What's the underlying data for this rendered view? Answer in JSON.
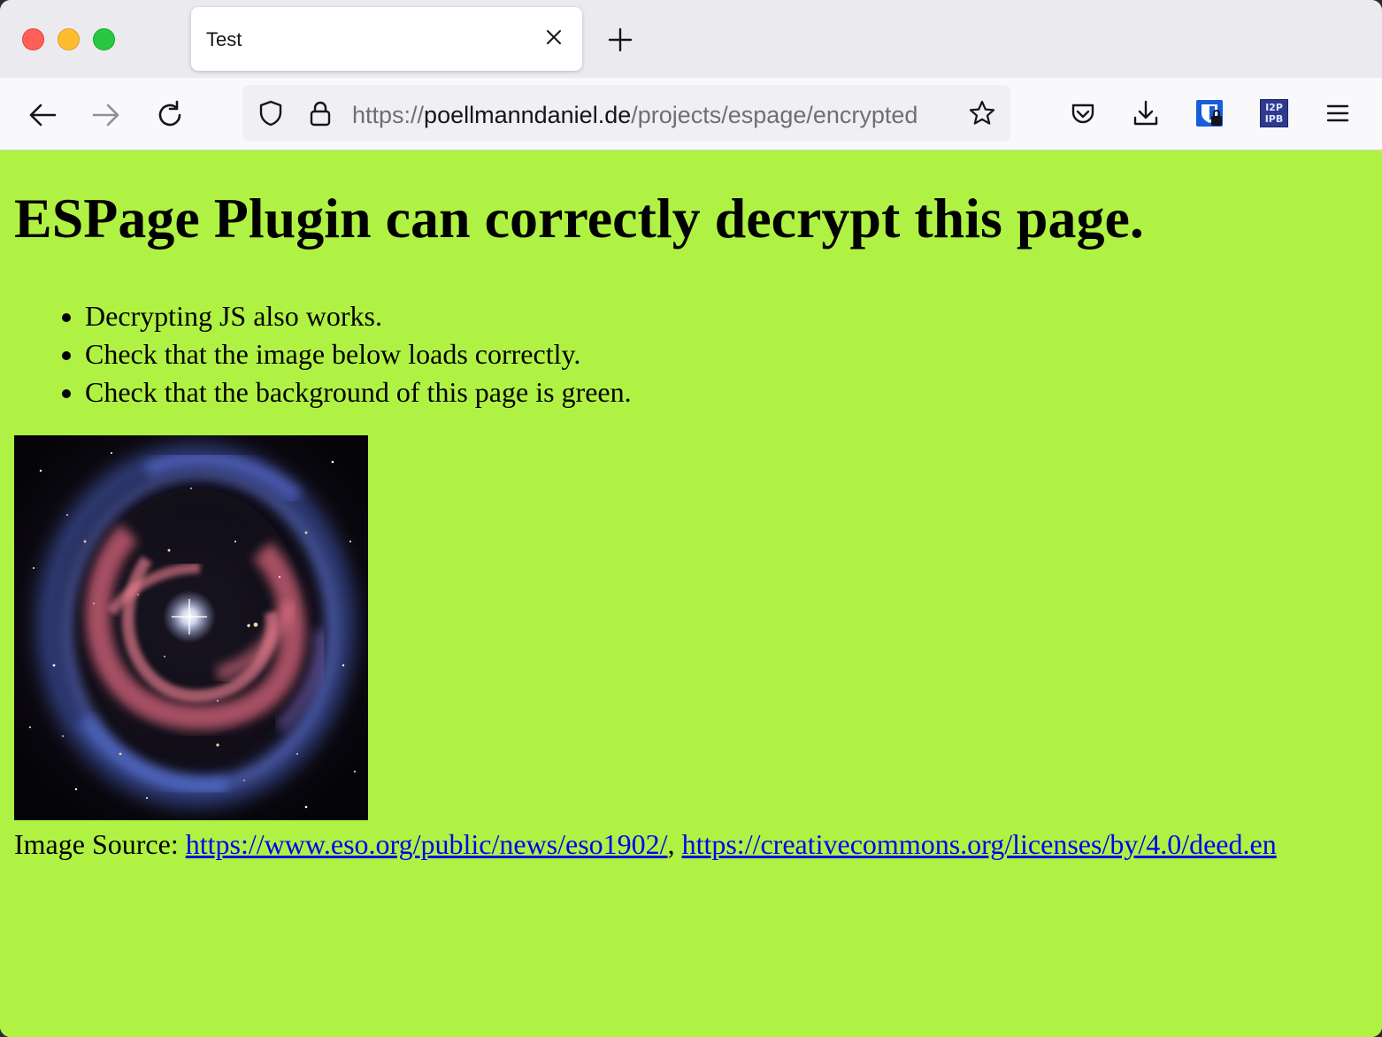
{
  "browser": {
    "tab": {
      "title": "Test"
    },
    "address": {
      "scheme": "https://",
      "host": "poellmanndaniel.de",
      "path": "/projects/espage/encrypted"
    },
    "extensions": {
      "i2p_badge_top": "I2P",
      "i2p_badge_bottom": "IPB"
    }
  },
  "page": {
    "background": "#b0f244",
    "heading": "ESPage Plugin can correctly decrypt this page.",
    "bullets": [
      "Decrypting JS also works.",
      "Check that the image below loads correctly.",
      "Check that the background of this page is green."
    ],
    "image_alt": "Planetary nebula",
    "caption": {
      "prefix": "Image Source: ",
      "link1": "https://www.eso.org/public/news/eso1902/",
      "separator": ", ",
      "link2": "https://creativecommons.org/licenses/by/4.0/deed.en"
    }
  }
}
